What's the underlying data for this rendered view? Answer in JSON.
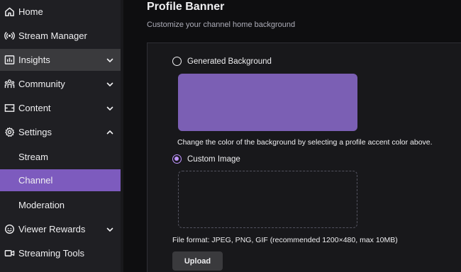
{
  "sidebar": {
    "items": [
      {
        "label": "Home",
        "icon": "home-icon"
      },
      {
        "label": "Stream Manager",
        "icon": "broadcast-icon"
      },
      {
        "label": "Insights",
        "icon": "insights-icon"
      },
      {
        "label": "Community",
        "icon": "community-icon"
      },
      {
        "label": "Content",
        "icon": "content-icon"
      },
      {
        "label": "Settings",
        "icon": "gear-icon"
      },
      {
        "label": "Stream"
      },
      {
        "label": "Channel"
      },
      {
        "label": "Moderation"
      },
      {
        "label": "Viewer Rewards",
        "icon": "rewards-icon"
      },
      {
        "label": "Streaming Tools",
        "icon": "camera-icon"
      }
    ]
  },
  "main": {
    "title": "Profile Banner",
    "subtitle": "Customize your channel home background",
    "generated_label": "Generated Background",
    "generated_selected": false,
    "preview_color": "#7b5fb4",
    "helper_text": "Change the color of the background by selecting a profile accent color above.",
    "custom_label": "Custom Image",
    "custom_selected": true,
    "file_format": "File format: JPEG, PNG, GIF (recommended 1200×480, max 10MB)",
    "upload_label": "Upload"
  },
  "colors": {
    "accent": "#7d5bbe",
    "radio_checked": "#bf94ff",
    "sidebar_bg": "#1f1f23",
    "main_bg": "#0e0e10"
  }
}
